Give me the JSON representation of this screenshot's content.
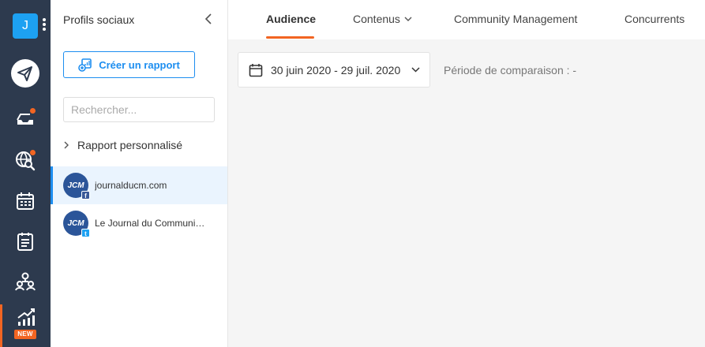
{
  "workspace": {
    "initial": "J"
  },
  "rail": {
    "items": [
      {
        "name": "publish",
        "icon": "paper-plane-icon"
      },
      {
        "name": "inbox",
        "icon": "inbox-icon",
        "notification": true
      },
      {
        "name": "listening",
        "icon": "globe-search-icon",
        "notification": true
      },
      {
        "name": "calendar",
        "icon": "calendar-icon"
      },
      {
        "name": "posts",
        "icon": "clipboard-list-icon"
      },
      {
        "name": "team",
        "icon": "users-network-icon"
      },
      {
        "name": "analytics",
        "icon": "bar-chart-icon",
        "active": true,
        "badge": "NEW"
      }
    ],
    "accent": "#f26522"
  },
  "panel": {
    "title": "Profils sociaux",
    "create_button": "Créer un rapport",
    "search_placeholder": "Rechercher...",
    "group_label": "Rapport personnalisé",
    "profiles": [
      {
        "name": "journalducm.com",
        "avatar": "JCM",
        "network": "facebook",
        "network_glyph": "f",
        "selected": true
      },
      {
        "name": "Le Journal du Communi…",
        "avatar": "JCM",
        "network": "twitter",
        "network_glyph": "t",
        "selected": false
      }
    ]
  },
  "tabs": [
    {
      "label": "Audience",
      "active": true
    },
    {
      "label": "Contenus",
      "has_dropdown": true
    },
    {
      "label": "Community Management"
    },
    {
      "label": "Concurrents"
    }
  ],
  "filters": {
    "date_range": "30 juin 2020 - 29 juil. 2020",
    "comparison": "Période de comparaison : -"
  },
  "colors": {
    "primary": "#1d8ef0",
    "accent": "#f26522",
    "rail": "#2d3a4e"
  }
}
